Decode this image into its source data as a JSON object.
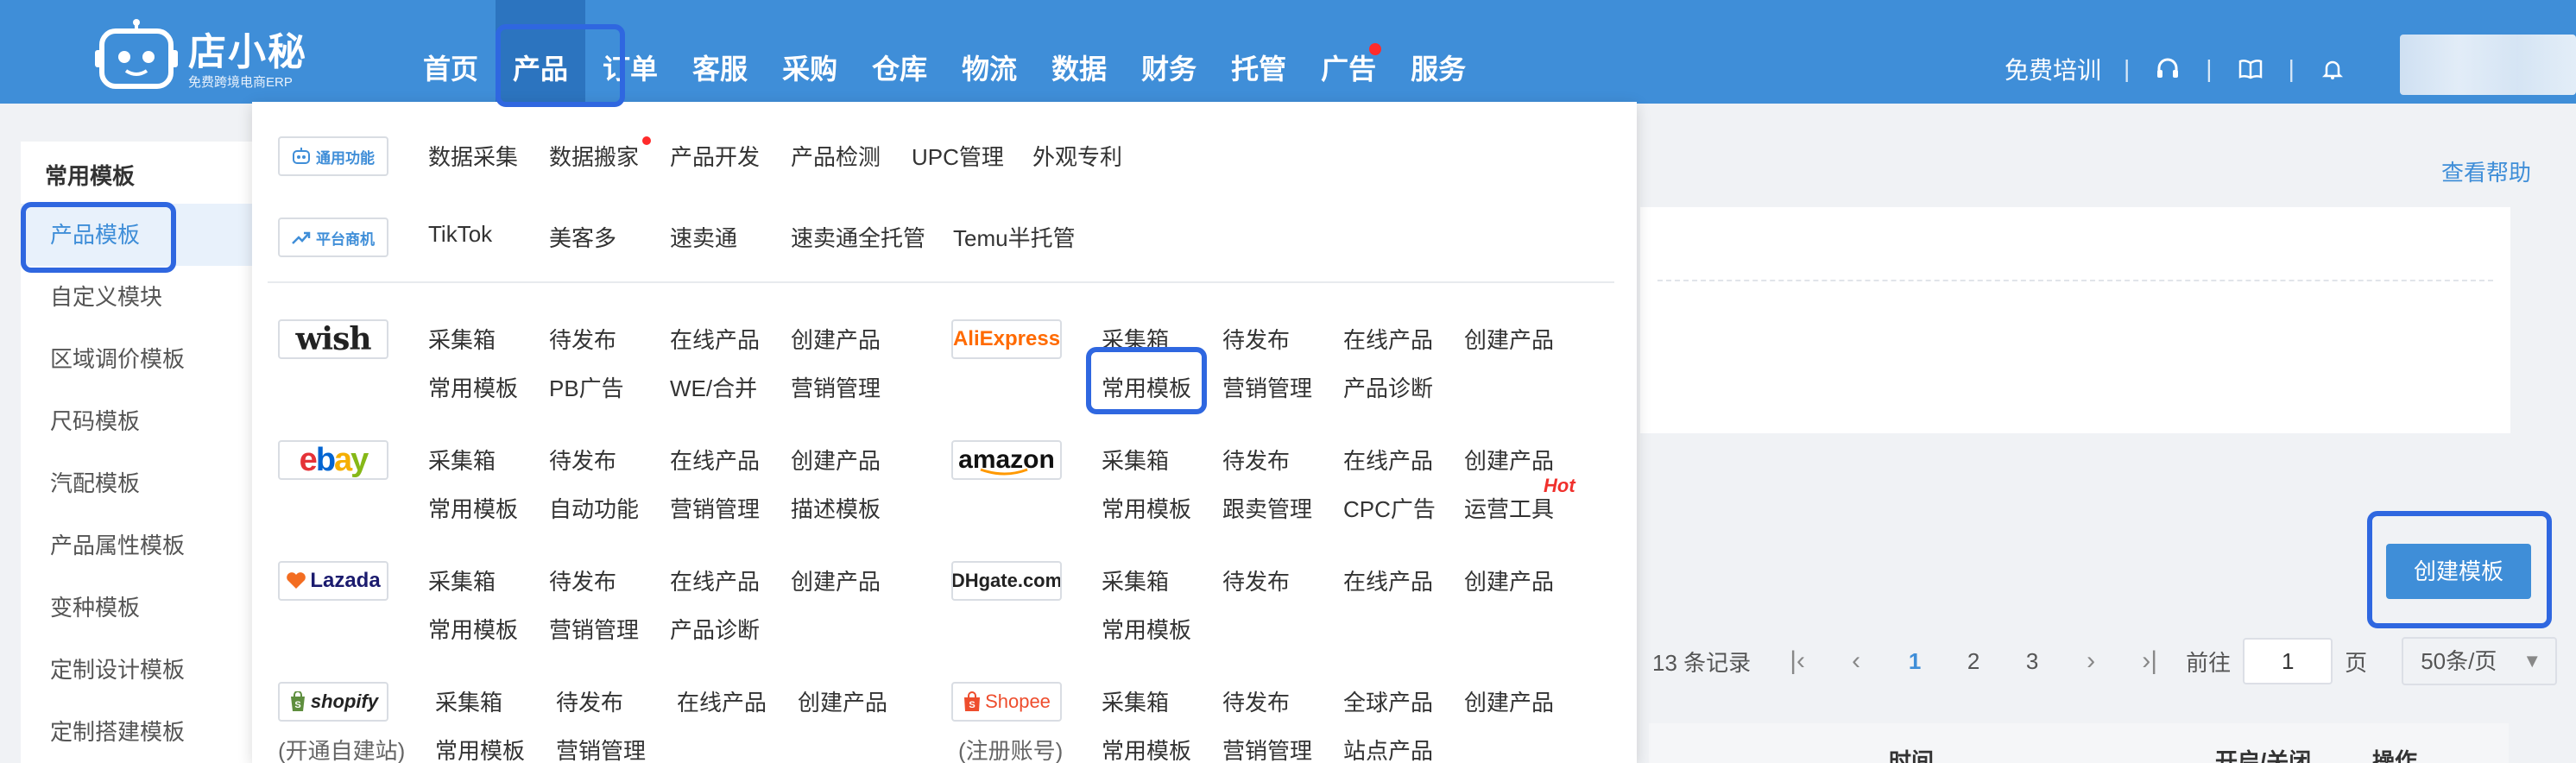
{
  "brand": {
    "name": "店小秘",
    "subtitle": "免费跨境电商ERP",
    "colors": {
      "primary": "#3f8ed8",
      "active_nav": "#2c74bf",
      "highlight_box": "#2f67e0",
      "hot": "#f0302c"
    }
  },
  "nav": {
    "items": [
      {
        "label": "首页"
      },
      {
        "label": "产品",
        "active": true
      },
      {
        "label": "订单"
      },
      {
        "label": "客服"
      },
      {
        "label": "采购"
      },
      {
        "label": "仓库"
      },
      {
        "label": "物流"
      },
      {
        "label": "数据"
      },
      {
        "label": "财务"
      },
      {
        "label": "托管"
      },
      {
        "label": "广告",
        "badge_dot": true
      },
      {
        "label": "服务"
      }
    ]
  },
  "header_right": {
    "training": "免费培训",
    "separator": "|",
    "icons": [
      "headset-icon",
      "book-icon",
      "bell-icon"
    ]
  },
  "sidebar": {
    "title": "常用模板",
    "items": [
      {
        "label": "产品模板",
        "active": true
      },
      {
        "label": "自定义模块"
      },
      {
        "label": "区域调价模板"
      },
      {
        "label": "尺码模板"
      },
      {
        "label": "汽配模板"
      },
      {
        "label": "产品属性模板"
      },
      {
        "label": "变种模板"
      },
      {
        "label": "定制设计模板"
      },
      {
        "label": "定制搭建模板"
      }
    ]
  },
  "main": {
    "help_link": "查看帮助",
    "create_button": "创建模板",
    "pagination": {
      "records": "13 条记录",
      "pages": [
        "1",
        "2",
        "3"
      ],
      "current_page": "1",
      "goto_label": "前往",
      "goto_value": "1",
      "page_unit": "页",
      "page_size": "50条/页"
    },
    "table_headers": [
      "时间",
      "开启/关闭",
      "操作"
    ]
  },
  "dropdown": {
    "general": {
      "badge": "通用功能",
      "links": [
        "数据采集",
        "数据搬家",
        "产品开发",
        "产品检测",
        "UPC管理",
        "外观专利"
      ]
    },
    "platform": {
      "badge": "平台商机",
      "links": [
        "TikTok",
        "美客多",
        "速卖通",
        "速卖通全托管",
        "Temu半托管"
      ]
    },
    "wish": {
      "logo": "wish",
      "row1": [
        "采集箱",
        "待发布",
        "在线产品",
        "创建产品"
      ],
      "row2": [
        "常用模板",
        "PB广告",
        "WE/合并",
        "营销管理"
      ]
    },
    "aliexpress": {
      "logo": "AliExpress",
      "row1": [
        "采集箱",
        "待发布",
        "在线产品",
        "创建产品"
      ],
      "row2": [
        "常用模板",
        "营销管理",
        "产品诊断"
      ]
    },
    "ebay": {
      "logo": "ebay",
      "row1": [
        "采集箱",
        "待发布",
        "在线产品",
        "创建产品"
      ],
      "row2": [
        "常用模板",
        "自动功能",
        "营销管理",
        "描述模板"
      ]
    },
    "amazon": {
      "logo": "amazon",
      "row1": [
        "采集箱",
        "待发布",
        "在线产品",
        "创建产品"
      ],
      "row2": [
        "常用模板",
        "跟卖管理",
        "CPC广告",
        "运营工具"
      ],
      "hot": "Hot"
    },
    "lazada": {
      "logo": "Lazada",
      "row1": [
        "采集箱",
        "待发布",
        "在线产品",
        "创建产品"
      ],
      "row2": [
        "常用模板",
        "营销管理",
        "产品诊断"
      ]
    },
    "dhgate": {
      "logo": "DHgate.com",
      "row1": [
        "采集箱",
        "待发布",
        "在线产品",
        "创建产品"
      ],
      "row2": [
        "常用模板"
      ]
    },
    "shopify": {
      "logo": "shopify",
      "caption": "(开通自建站)",
      "row1": [
        "采集箱",
        "待发布",
        "在线产品",
        "创建产品"
      ],
      "row2": [
        "常用模板",
        "营销管理"
      ]
    },
    "shopee": {
      "logo": "Shopee",
      "caption": "(注册账号)",
      "row1": [
        "采集箱",
        "待发布",
        "全球产品",
        "创建产品"
      ],
      "row2": [
        "常用模板",
        "营销管理",
        "站点产品"
      ]
    }
  }
}
